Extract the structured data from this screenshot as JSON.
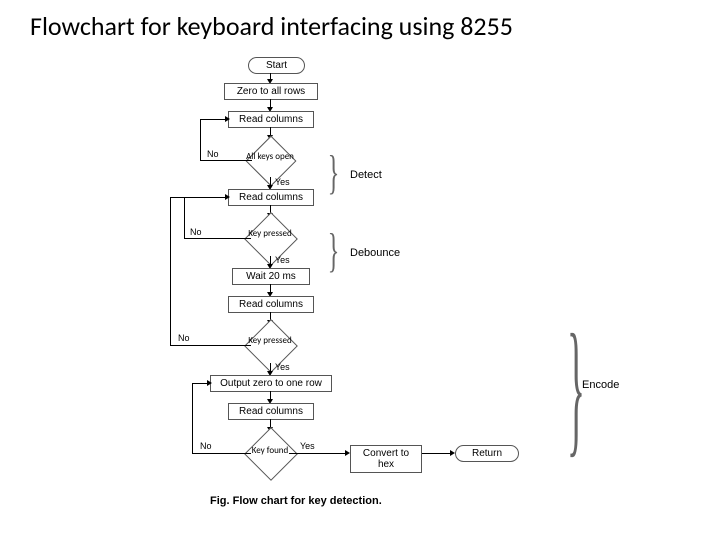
{
  "title": "Flowchart for keyboard interfacing using 8255",
  "caption": "Fig. Flow chart for key detection.",
  "nodes": {
    "start": "Start",
    "zero_all": "Zero to all rows",
    "read_cols_1": "Read columns",
    "all_keys_open": "All keys open",
    "read_cols_2": "Read columns",
    "key_pressed_1": "Key pressed",
    "wait": "Wait 20 ms",
    "read_cols_3": "Read columns",
    "key_pressed_2": "Key pressed",
    "output_zero": "Output zero to one row",
    "read_cols_4": "Read columns",
    "key_found": "Key found",
    "convert": "Convert to hex",
    "return": "Return"
  },
  "labels": {
    "yes": "Yes",
    "no": "No"
  },
  "phases": {
    "detect": "Detect",
    "debounce": "Debounce",
    "encode": "Encode"
  }
}
